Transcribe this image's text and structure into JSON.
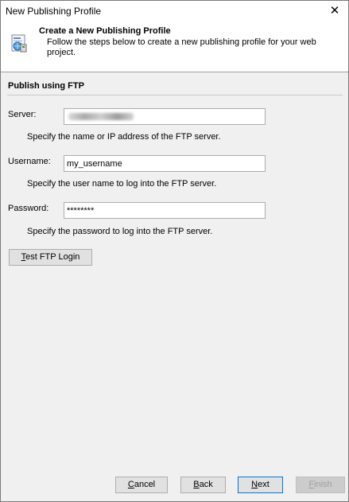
{
  "window": {
    "title": "New Publishing Profile",
    "close_glyph": "✕"
  },
  "header": {
    "title": "Create a New Publishing Profile",
    "description": "Follow the steps below to create a new publishing profile for your web project.",
    "icon": "publishing-profile-icon"
  },
  "section": {
    "title": "Publish using FTP"
  },
  "server": {
    "label": "Server:",
    "value": "",
    "hint": "Specify the name or IP address of the FTP server."
  },
  "username": {
    "label": "Username:",
    "value": "my_username",
    "hint": "Specify the user name to log into the FTP server."
  },
  "password": {
    "label": "Password:",
    "value": "********",
    "hint": "Specify the password to log into the FTP server."
  },
  "test_button": {
    "first": "T",
    "rest": "est FTP Login"
  },
  "footer": {
    "cancel": {
      "first": "C",
      "rest": "ancel"
    },
    "back": {
      "first": "B",
      "rest": "ack"
    },
    "next": {
      "first": "N",
      "rest": "ext"
    },
    "finish": {
      "first": "F",
      "rest": "inish"
    }
  }
}
